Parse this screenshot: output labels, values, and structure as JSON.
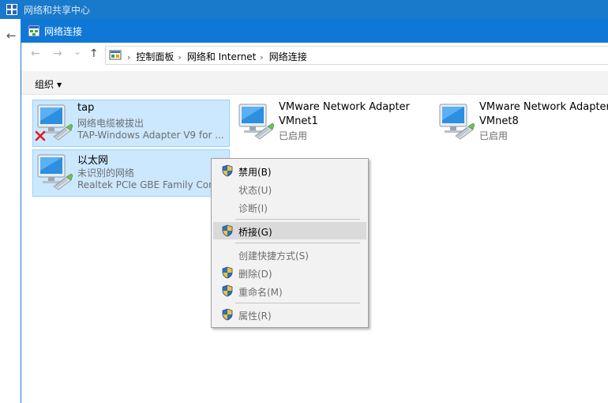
{
  "background_window": {
    "title": "网络和共享中心",
    "back_arrow": "←"
  },
  "window": {
    "title": "网络连接"
  },
  "nav": {
    "back": "←",
    "forward": "→",
    "dropdown": "⌄",
    "up": "↑"
  },
  "breadcrumb": {
    "items": [
      "控制面板",
      "网络和 Internet",
      "网络连接"
    ],
    "separator": "›"
  },
  "command_bar": {
    "organize": "组织",
    "caret": "▼"
  },
  "connections": [
    {
      "name": "tap",
      "status": "网络电缆被拔出",
      "device": "TAP-Windows Adapter V9 for ...",
      "disconnected": true,
      "selected": true
    },
    {
      "name": "VMware Network Adapter",
      "status": "VMnet1",
      "device": "已启用",
      "selected": false
    },
    {
      "name": "VMware Network Adapter",
      "status": "VMnet8",
      "device": "已启用",
      "selected": false
    },
    {
      "name": "以太网",
      "status": "未识别的网络",
      "device": "Realtek PCIe GBE Family Cont",
      "selected": true
    }
  ],
  "context_menu": {
    "items": [
      {
        "label": "禁用(B)",
        "enabled": true,
        "shield": true
      },
      {
        "label": "状态(U)",
        "enabled": false,
        "shield": false
      },
      {
        "label": "诊断(I)",
        "enabled": false,
        "shield": false
      },
      {
        "label": "桥接(G)",
        "enabled": true,
        "shield": true,
        "highlighted": true
      },
      {
        "label": "创建快捷方式(S)",
        "enabled": false,
        "shield": false
      },
      {
        "label": "删除(D)",
        "enabled": false,
        "shield": true
      },
      {
        "label": "重命名(M)",
        "enabled": false,
        "shield": true
      },
      {
        "label": "属性(R)",
        "enabled": false,
        "shield": true
      }
    ]
  },
  "colors": {
    "titlebar": "#0f78d7",
    "selection": "#cce8ff",
    "selection_border": "#99d1ff",
    "menu_bg": "#f2f2f2"
  }
}
